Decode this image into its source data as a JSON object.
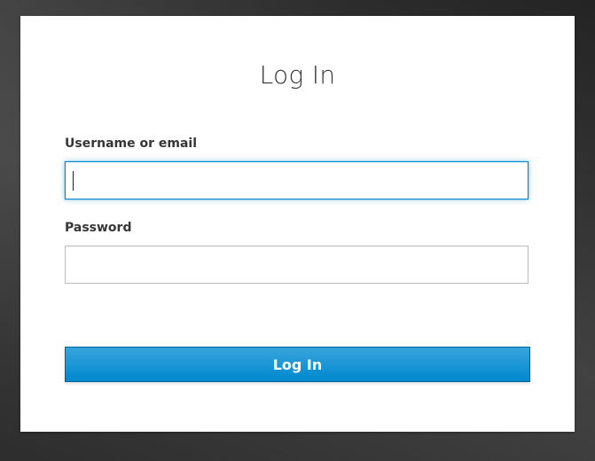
{
  "login": {
    "title": "Log In",
    "username_label": "Username or email",
    "username_value": "",
    "password_label": "Password",
    "password_value": "",
    "submit_label": "Log In"
  },
  "colors": {
    "accent": "#0088ce",
    "button_top": "#39a5dc",
    "button_bottom": "#0088ce",
    "text": "#363636",
    "card": "#ffffff",
    "background": "#3a3a3a"
  }
}
